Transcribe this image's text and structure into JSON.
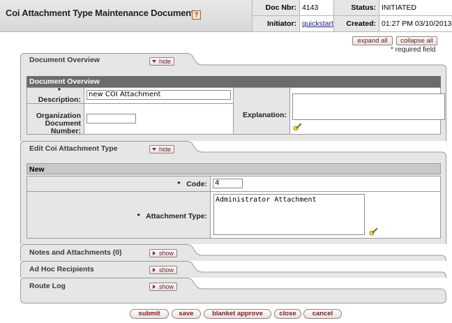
{
  "header": {
    "title": "Coi Attachment Type Maintenance Document",
    "help_icon": "?",
    "doc_nbr_label": "Doc Nbr:",
    "doc_nbr_value": "4143",
    "status_label": "Status:",
    "status_value": "INITIATED",
    "initiator_label": "Initiator:",
    "initiator_value": "quickstart",
    "created_label": "Created:",
    "created_value": "01:27 PM 03/10/2013"
  },
  "controls": {
    "expand_all": "expand all",
    "collapse_all": "collapse all",
    "required_note": "* required field"
  },
  "document_overview": {
    "tab_label": "Document Overview",
    "toggle_label": "hide",
    "section_title": "Document Overview",
    "description_required": "*",
    "description_label": "Description:",
    "description_value": "new COI Attachment",
    "org_doc_label_1": "Organization",
    "org_doc_label_2": "Document",
    "org_doc_label_3": "Number:",
    "org_doc_value": "",
    "explanation_label": "Explanation:",
    "explanation_value": ""
  },
  "edit_section": {
    "tab_label": "Edit Coi Attachment Type",
    "toggle_label": "hide",
    "sub_title": "New",
    "code_required": "*",
    "code_label": "Code:",
    "code_value": "4",
    "attachment_type_required": "*",
    "attachment_type_label": "Attachment Type:",
    "attachment_type_value": "Administrator Attachment"
  },
  "collapsed_tabs": [
    {
      "label": "Notes and Attachments (0)",
      "toggle": "show"
    },
    {
      "label": "Ad Hoc Recipients",
      "toggle": "show"
    },
    {
      "label": "Route Log",
      "toggle": "show"
    }
  ],
  "actions": {
    "submit": "submit",
    "save": "save",
    "blanket_approve": "blanket approve",
    "close": "close",
    "cancel": "cancel"
  },
  "icons": {
    "help": "help-icon",
    "expand_textarea": "pencil-expand-icon"
  },
  "colors": {
    "header_bg": "#dcdcdc",
    "section_header_bg": "#6b6b6b",
    "button_text": "#7a1a1a"
  }
}
